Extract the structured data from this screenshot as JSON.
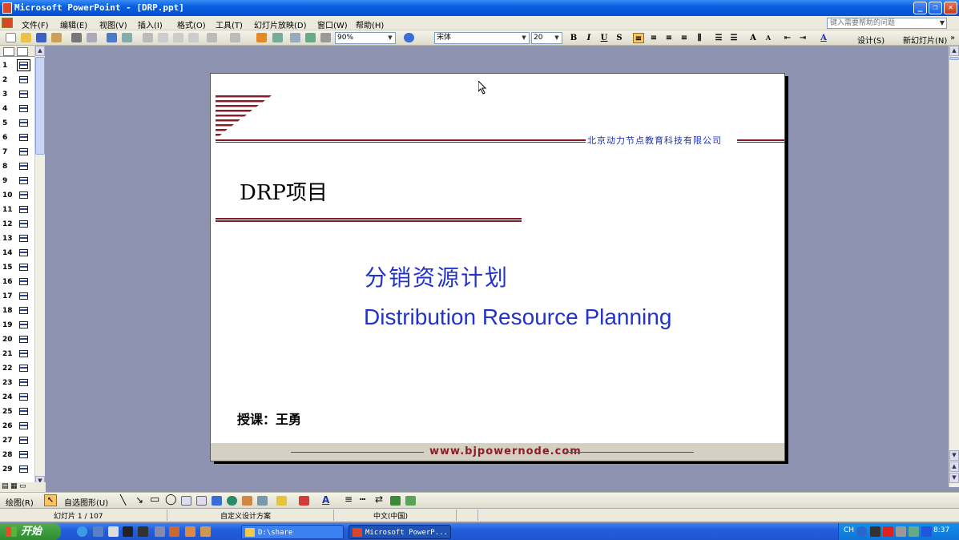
{
  "window": {
    "title": "Microsoft PowerPoint - [DRP.ppt]",
    "buttons": {
      "minimize": "_",
      "restore": "❐",
      "close": "✕"
    }
  },
  "menubar": {
    "items": [
      "文件(F)",
      "编辑(E)",
      "视图(V)",
      "插入(I)",
      "格式(O)",
      "工具(T)",
      "幻灯片放映(D)",
      "窗口(W)",
      "帮助(H)"
    ],
    "help_placeholder": "键入需要帮助的问题"
  },
  "toolbar": {
    "zoom": "90%",
    "font_name": "宋体",
    "font_size": "20",
    "bold": "B",
    "italic": "I",
    "underline": "U",
    "shadow": "S",
    "design_label": "设计(S)",
    "new_slide_label": "新幻灯片(N)"
  },
  "outline": {
    "slide_numbers": [
      "1",
      "2",
      "3",
      "4",
      "5",
      "6",
      "7",
      "8",
      "9",
      "10",
      "11",
      "12",
      "13",
      "14",
      "15",
      "16",
      "17",
      "18",
      "19",
      "20",
      "21",
      "22",
      "23",
      "24",
      "25",
      "26",
      "27",
      "28",
      "29"
    ],
    "selected": "1"
  },
  "slide": {
    "company": "北京动力节点教育科技有限公司",
    "title": "DRP项目",
    "subtitle_cn": "分销资源计划",
    "subtitle_en": "Distribution Resource Planning",
    "lecturer": "授课：王勇",
    "footer_url": "www.bjpowernode.com"
  },
  "drawbar": {
    "draw_label": "绘图(R)",
    "autoshapes_label": "自选图形(U)"
  },
  "status": {
    "slide_position": "幻灯片 1 / 107",
    "design": "自定义设计方案",
    "language": "中文(中国)"
  },
  "taskbar": {
    "start_label": "开始",
    "tasks": [
      "D:\\share",
      "Microsoft PowerP..."
    ],
    "tray_lang": "CH",
    "clock": "8:37"
  },
  "colors": {
    "title_blue": "#2233cc",
    "accent_red": "#7d1a26",
    "company_blue": "#1c32b5"
  }
}
